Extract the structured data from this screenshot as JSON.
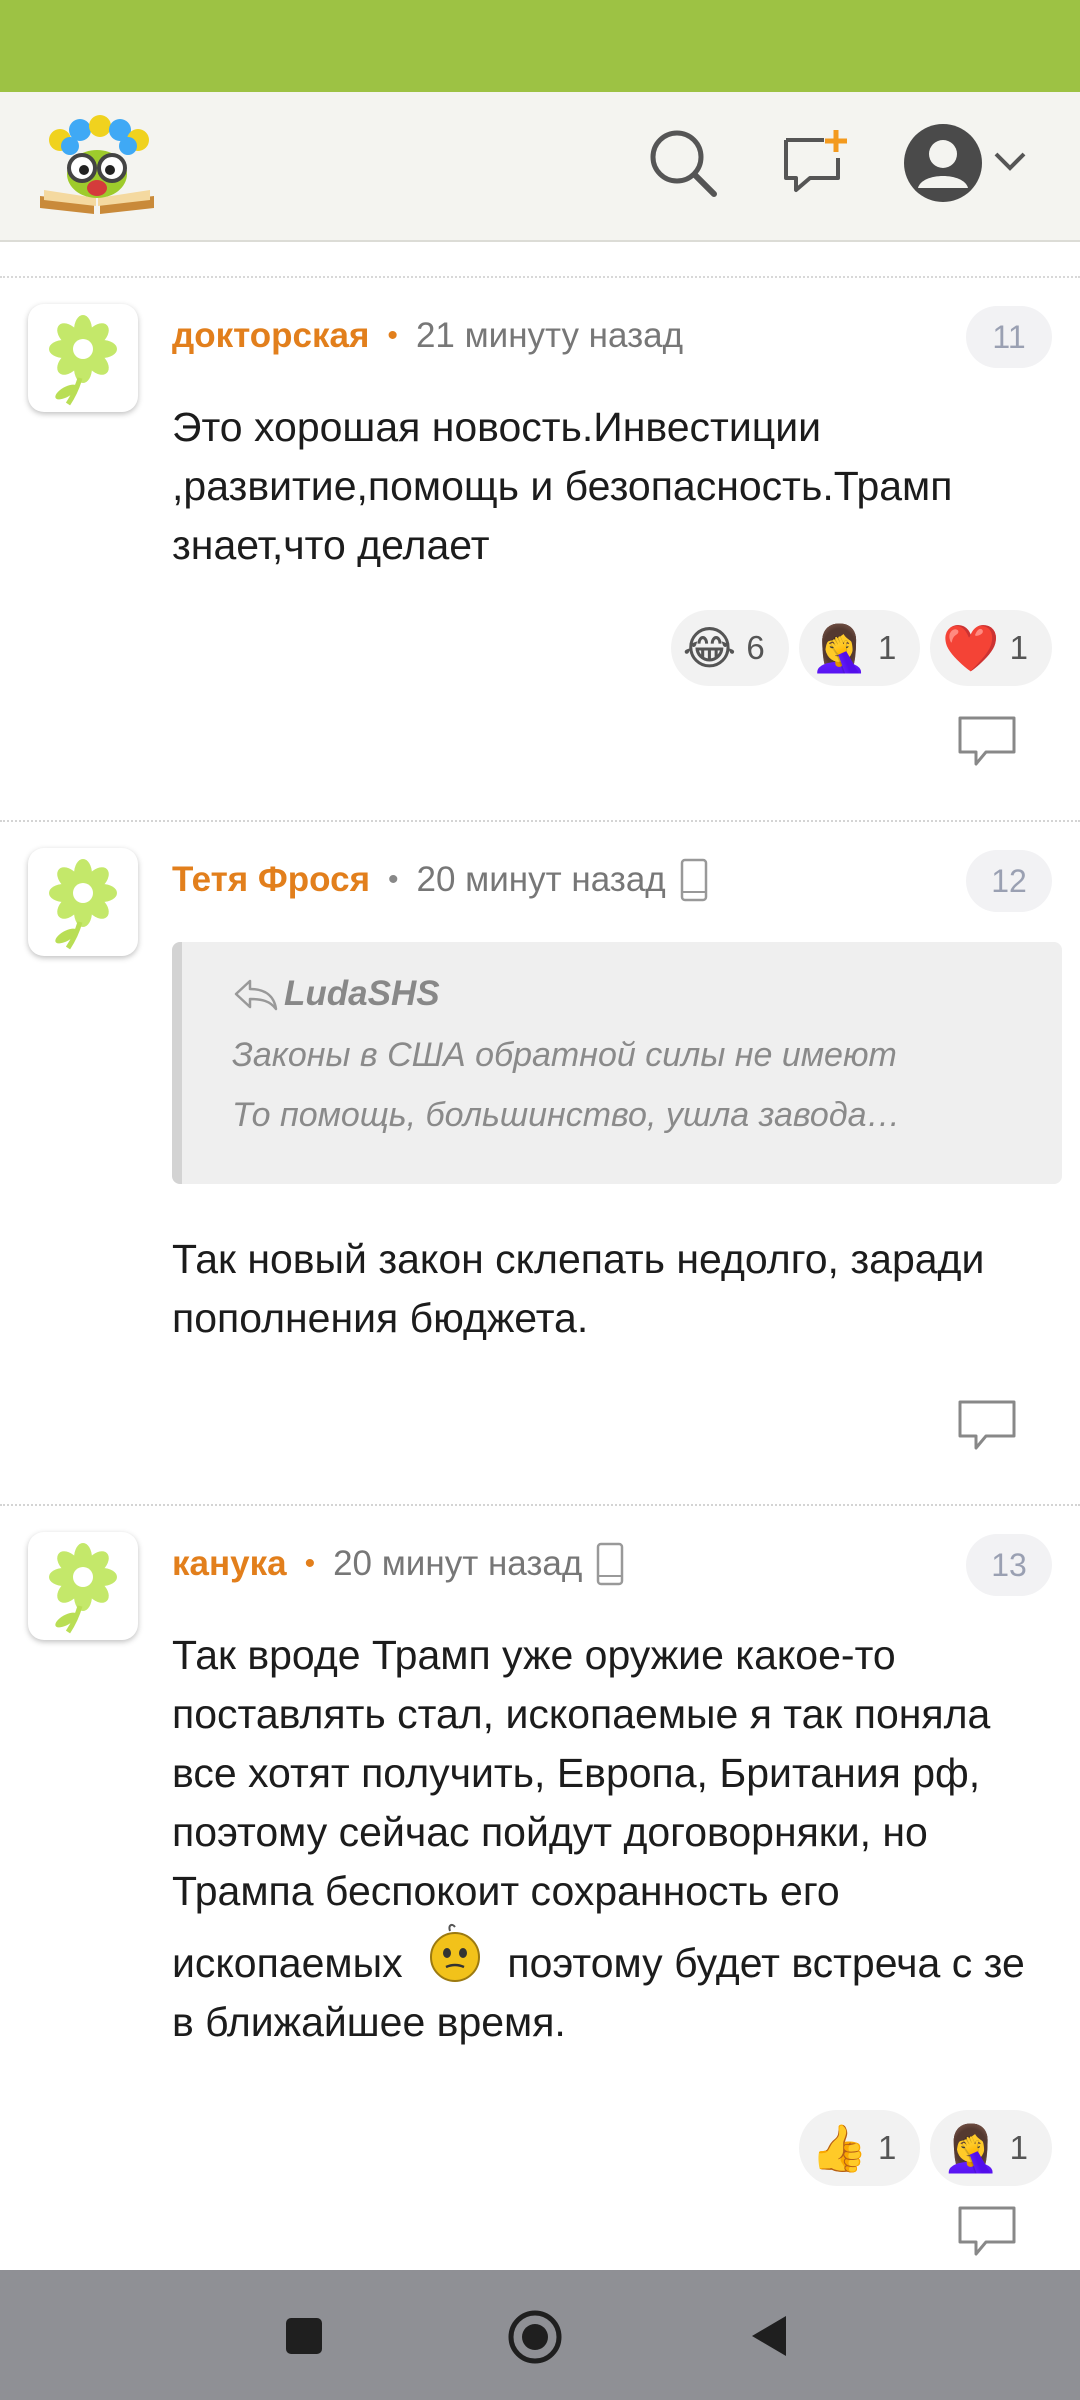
{
  "colors": {
    "status_bar": "#9dc244",
    "author": "#e27f1c",
    "nav_bar": "#8f9095"
  },
  "appbar": {
    "logo_icon": "reading-glasses-flower-logo",
    "icons": [
      "search-icon",
      "new-post-icon",
      "profile-avatar-icon",
      "chevron-down-icon"
    ]
  },
  "comments": [
    {
      "author": "докторская",
      "time": "21 минуту назад",
      "number": "11",
      "has_device_icon": false,
      "text": "Это хорошая новость.Инвестиции ,развитие,помощь и безопасность.Трамп знает,что делает",
      "reactions": [
        {
          "emoji": "😂",
          "count": "6"
        },
        {
          "emoji": "🤦‍♀️",
          "count": "1"
        },
        {
          "emoji": "❤️",
          "count": "1"
        }
      ]
    },
    {
      "author": "Тетя Фрося",
      "time": "20 минут назад",
      "number": "12",
      "has_device_icon": true,
      "quote": {
        "author": "LudaSHS",
        "line1": "Законы в США обратной силы не имеют",
        "line2": "То   помощь,   большинство,   ушла   завода…"
      },
      "text": "Так новый закон склепать недолго, заради пополнения бюджета."
    },
    {
      "author": "канука",
      "time": "20 минут назад",
      "number": "13",
      "has_device_icon": true,
      "text_part1": "Так вроде Трамп уже оружие какое-то поставлять стал, ископаемые я так поняла все хотят получить, Европа, Британия рф, поэтому сейчас пойдут договорняки, но Трампа беспокоит сохранность его ископаемых",
      "text_part2": "поэтому будет встреча с зе в ближайшее время.",
      "inline_icon": "thinking-smiley-icon",
      "reactions": [
        {
          "emoji": "👍",
          "count": "1"
        },
        {
          "emoji": "🤦‍♀️",
          "count": "1"
        }
      ]
    }
  ],
  "navbar": {
    "buttons": [
      "recents-button",
      "home-button",
      "back-button"
    ]
  }
}
